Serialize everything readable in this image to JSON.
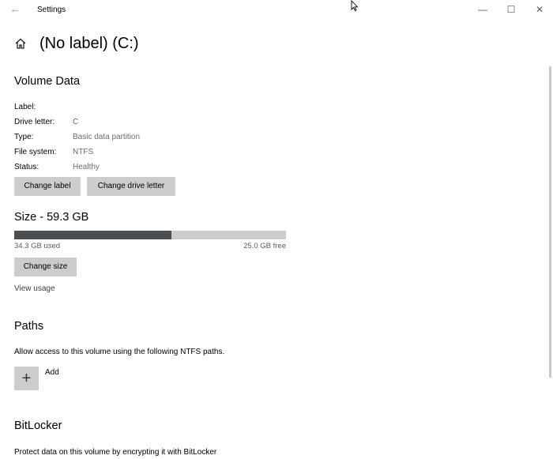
{
  "window": {
    "title": "Settings",
    "back_icon": "back-arrow-icon",
    "minimize_icon": "minimize-icon",
    "maximize_icon": "maximize-icon",
    "close_icon": "close-icon"
  },
  "header": {
    "home_icon": "home-icon",
    "title": "(No label) (C:)"
  },
  "volume_data": {
    "heading": "Volume Data",
    "properties": [
      {
        "label": "Label:",
        "value": ""
      },
      {
        "label": "Drive letter:",
        "value": "C"
      },
      {
        "label": "Type:",
        "value": "Basic data partition"
      },
      {
        "label": "File system:",
        "value": "NTFS"
      },
      {
        "label": "Status:",
        "value": "Healthy"
      }
    ],
    "change_label_button": "Change label",
    "change_drive_letter_button": "Change drive letter"
  },
  "size": {
    "heading": "Size - 59.3 GB",
    "used_text": "34.3 GB used",
    "free_text": "25.0 GB free",
    "used_fraction": 0.578,
    "bar_fill_color": "#4c4f52",
    "bar_track_color": "#cccccc",
    "change_size_button": "Change size",
    "view_usage_link": "View usage"
  },
  "paths": {
    "heading": "Paths",
    "description": "Allow access to this volume using the following NTFS paths.",
    "add_label": "Add",
    "add_icon": "plus-icon"
  },
  "bitlocker": {
    "heading": "BitLocker",
    "description": "Protect data on this volume by encrypting it with BitLocker"
  }
}
